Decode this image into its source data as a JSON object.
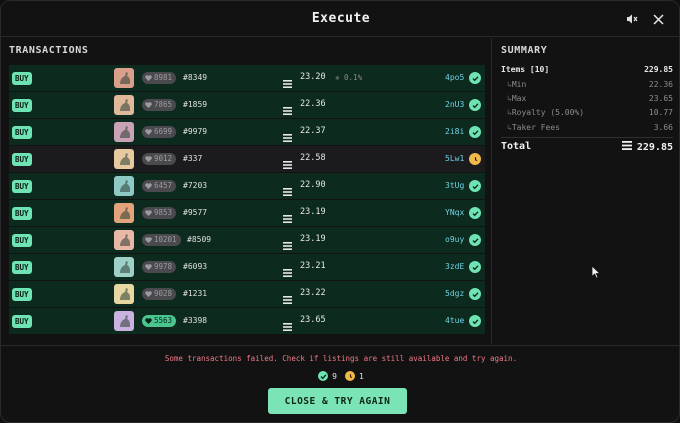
{
  "header": {
    "title": "Execute",
    "mute_icon": "speaker-muted-icon",
    "close_icon": "close-icon"
  },
  "transactions": {
    "title": "TRANSACTIONS",
    "buy_label": "BUY",
    "rows": [
      {
        "rank": "8981",
        "token": "#8349",
        "price": "23.20",
        "fee": "0.1%",
        "hash": "4po5",
        "status": "success",
        "thumb": "#d8a08a"
      },
      {
        "rank": "7865",
        "token": "#1859",
        "price": "22.36",
        "fee": "",
        "hash": "2nU3",
        "status": "success",
        "thumb": "#e0b89a"
      },
      {
        "rank": "6699",
        "token": "#9979",
        "price": "22.37",
        "fee": "",
        "hash": "2i8i",
        "status": "success",
        "thumb": "#c9a3b5"
      },
      {
        "rank": "9012",
        "token": "#337",
        "price": "22.58",
        "fee": "",
        "hash": "5Lw1",
        "status": "pending",
        "thumb": "#e7c9a0"
      },
      {
        "rank": "6457",
        "token": "#7203",
        "price": "22.90",
        "fee": "",
        "hash": "3tUg",
        "status": "success",
        "thumb": "#8ec9c6"
      },
      {
        "rank": "9853",
        "token": "#9577",
        "price": "23.19",
        "fee": "",
        "hash": "YNqx",
        "status": "success",
        "thumb": "#e3a47c"
      },
      {
        "rank": "10201",
        "token": "#8509",
        "price": "23.19",
        "fee": "",
        "hash": "o9uy",
        "status": "success",
        "thumb": "#e8b7a6"
      },
      {
        "rank": "9978",
        "token": "#6093",
        "price": "23.21",
        "fee": "",
        "hash": "3zdE",
        "status": "success",
        "thumb": "#9fd0c8"
      },
      {
        "rank": "9028",
        "token": "#1231",
        "price": "23.22",
        "fee": "",
        "hash": "5dgz",
        "status": "success",
        "thumb": "#e6d7a3"
      },
      {
        "rank": "5563",
        "token": "#3398",
        "price": "23.65",
        "fee": "",
        "hash": "4tue",
        "status": "success",
        "thumb": "#c9b1e0",
        "rank_highlight": true
      }
    ]
  },
  "summary": {
    "title": "SUMMARY",
    "items_label": "Items [10]",
    "items_value": "229.85",
    "min_label": "Min",
    "min_value": "22.36",
    "max_label": "Max",
    "max_value": "23.65",
    "royalty_label": "Royalty (5.00%)",
    "royalty_value": "10.77",
    "taker_label": "Taker Fees",
    "taker_value": "3.66",
    "total_label": "Total",
    "total_value": "229.85"
  },
  "footer": {
    "error_message": "Some transactions failed. Check if listings are still available and try again.",
    "success_count": "9",
    "pending_count": "1",
    "button_label": "CLOSE & TRY AGAIN"
  },
  "colors": {
    "accent": "#7be4b6",
    "row_bg": "#0c2a1d",
    "error": "#f07a86",
    "hash": "#6fd2e8",
    "pending": "#f0b94a"
  }
}
